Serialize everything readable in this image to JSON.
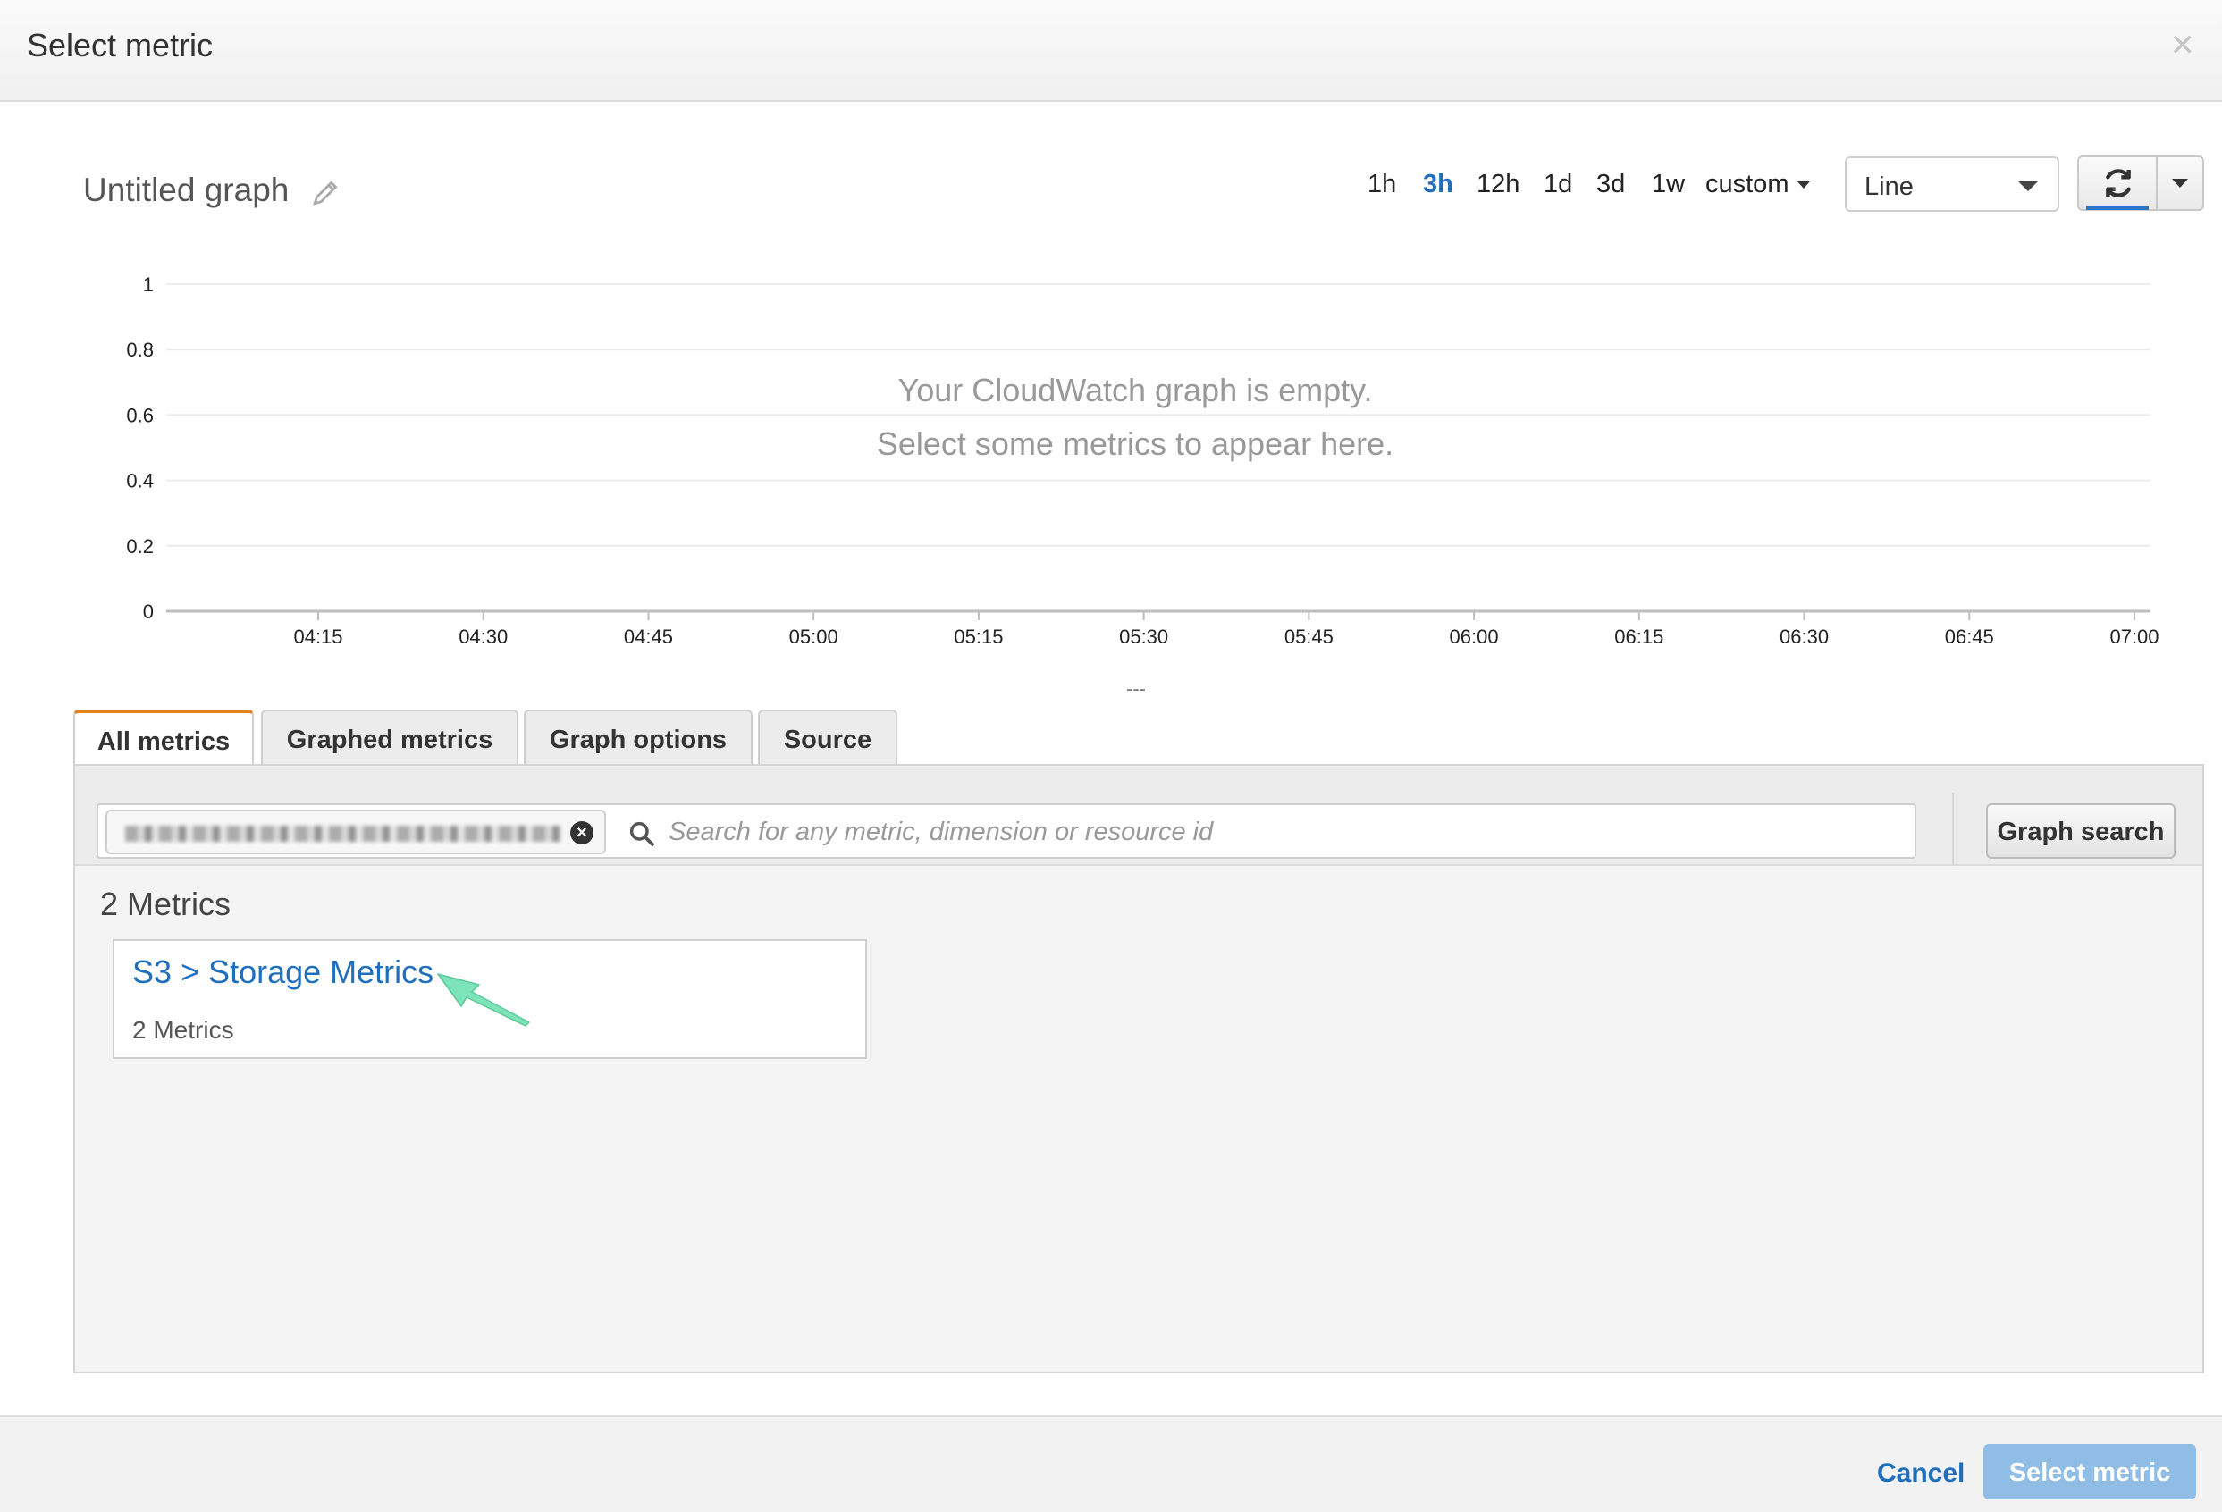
{
  "dialog": {
    "title": "Select metric",
    "close_icon": "close-icon"
  },
  "graph": {
    "title": "Untitled graph",
    "edit_icon": "pencil-icon",
    "time_ranges": [
      {
        "label": "1h",
        "active": false
      },
      {
        "label": "3h",
        "active": true
      },
      {
        "label": "12h",
        "active": false
      },
      {
        "label": "1d",
        "active": false
      },
      {
        "label": "3d",
        "active": false
      },
      {
        "label": "1w",
        "active": false
      }
    ],
    "custom_label": "custom",
    "chart_type_selected": "Line",
    "refresh_icon": "refresh-icon",
    "empty_line1": "Your CloudWatch graph is empty.",
    "empty_line2": "Select some metrics to appear here.",
    "legend_placeholder": "---",
    "y_ticks": [
      "1",
      "0.8",
      "0.6",
      "0.4",
      "0.2",
      "0"
    ],
    "x_ticks": [
      "04:15",
      "04:30",
      "04:45",
      "05:00",
      "05:15",
      "05:30",
      "05:45",
      "06:00",
      "06:15",
      "06:30",
      "06:45",
      "07:00"
    ]
  },
  "tabs": [
    {
      "label": "All metrics",
      "active": true
    },
    {
      "label": "Graphed metrics",
      "active": false
    },
    {
      "label": "Graph options",
      "active": false
    },
    {
      "label": "Source",
      "active": false
    }
  ],
  "search": {
    "placeholder": "Search for any metric, dimension or resource id",
    "value": "",
    "graph_search_label": "Graph search"
  },
  "results": {
    "count_label": "2 Metrics",
    "cards": [
      {
        "title": "S3 > Storage Metrics",
        "subtitle": "2 Metrics"
      }
    ]
  },
  "footer": {
    "cancel_label": "Cancel",
    "select_label": "Select metric"
  },
  "colors": {
    "accent_blue": "#1f6fbd",
    "tab_active_border": "#e5821b",
    "primary_disabled": "#8fbde6",
    "annotation_arrow": "#7de3b8"
  }
}
